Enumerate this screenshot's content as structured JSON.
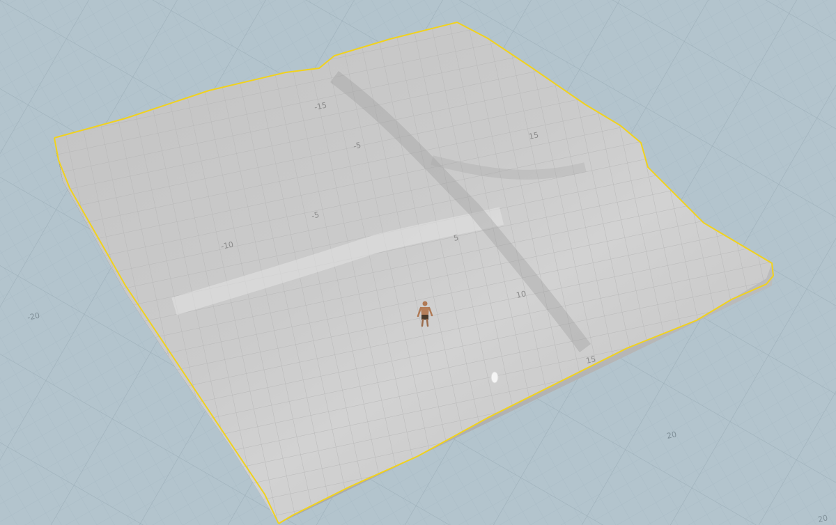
{
  "viewport": {
    "colors": {
      "background": "#b3c4cd",
      "grid_major": "#a3b5bf",
      "grid_minor": "#aabcc6",
      "terrain_top": "#c7c7c7",
      "terrain_side": "#2f2f2f",
      "selection_outline": "#f1d21d"
    },
    "floor_grid_labels": [
      {
        "text": "-20",
        "tick": "floor-x-neg20"
      },
      {
        "text": "20",
        "tick": "floor-x-20"
      },
      {
        "text": "20",
        "tick": "floor-y-20"
      }
    ],
    "surface_grid_labels": [
      {
        "text": "-10",
        "tick": "surf-neg10"
      },
      {
        "text": "-5",
        "tick": "surf-neg5"
      },
      {
        "text": "5",
        "tick": "surf-5"
      },
      {
        "text": "10",
        "tick": "surf-10"
      },
      {
        "text": "15",
        "tick": "surf-15"
      },
      {
        "text": "15",
        "tick": "surf-15b"
      },
      {
        "text": "-15",
        "tick": "surf-neg15"
      },
      {
        "text": "-5",
        "tick": "surf-neg5b"
      }
    ]
  },
  "terrain": {
    "name": "heightfield-terrain",
    "selected": true
  },
  "character": {
    "icon": "human-figure-icon"
  },
  "marker": {
    "icon": "footprint-marker-icon"
  }
}
